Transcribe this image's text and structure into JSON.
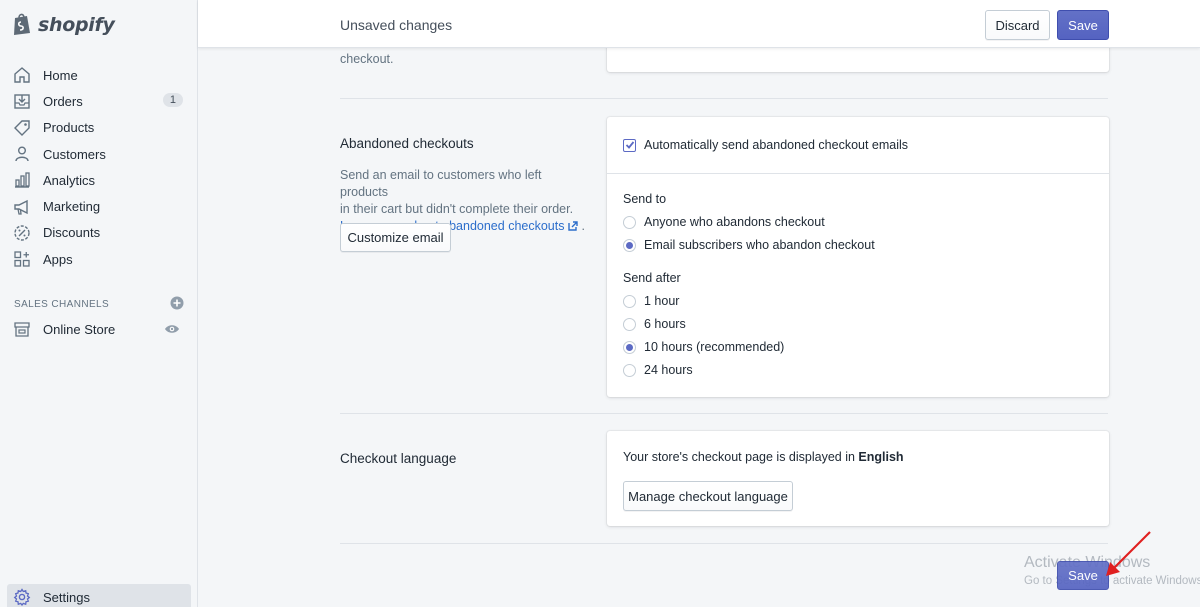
{
  "app": {
    "logo_text": "shopify"
  },
  "sidebar": {
    "items": [
      {
        "label": "Home",
        "icon": "home-icon"
      },
      {
        "label": "Orders",
        "icon": "orders-icon",
        "badge": "1"
      },
      {
        "label": "Products",
        "icon": "tag-icon"
      },
      {
        "label": "Customers",
        "icon": "person-icon"
      },
      {
        "label": "Analytics",
        "icon": "bar-chart-icon"
      },
      {
        "label": "Marketing",
        "icon": "megaphone-icon"
      },
      {
        "label": "Discounts",
        "icon": "discount-icon"
      },
      {
        "label": "Apps",
        "icon": "apps-icon"
      }
    ],
    "channels_heading": "SALES CHANNELS",
    "online_store": "Online Store",
    "settings": "Settings"
  },
  "topbar": {
    "title": "Unsaved changes",
    "discard": "Discard",
    "save": "Save"
  },
  "previous_section": {
    "text_tail": "checkout."
  },
  "abandoned": {
    "heading": "Abandoned checkouts",
    "description_1": "Send an email to customers who left products",
    "description_2": "in their cart but didn't complete their order.",
    "learn_more": "Learn more about abandoned checkouts",
    "learn_more_suffix": ".",
    "customize_button": "Customize email",
    "auto_send_label": "Automatically send abandoned checkout emails",
    "send_to_label": "Send to",
    "send_to_options": [
      {
        "label": "Anyone who abandons checkout",
        "selected": false
      },
      {
        "label": "Email subscribers who abandon checkout",
        "selected": true
      }
    ],
    "send_after_label": "Send after",
    "send_after_options": [
      {
        "label": "1 hour",
        "selected": false
      },
      {
        "label": "6 hours",
        "selected": false
      },
      {
        "label": "10 hours (recommended)",
        "selected": true
      },
      {
        "label": "24 hours",
        "selected": false
      }
    ]
  },
  "language": {
    "heading": "Checkout language",
    "description": "Your store's checkout page is displayed in",
    "language": "English",
    "manage_button": "Manage checkout language"
  },
  "bottom": {
    "save": "Save"
  },
  "watermark": {
    "line1": "Activate Windows",
    "line2": "Go to Settings to activate Windows."
  },
  "colors": {
    "primary": "#5c6ac4",
    "annotation_arrow": "#e02020",
    "link": "#2c6ecb"
  }
}
